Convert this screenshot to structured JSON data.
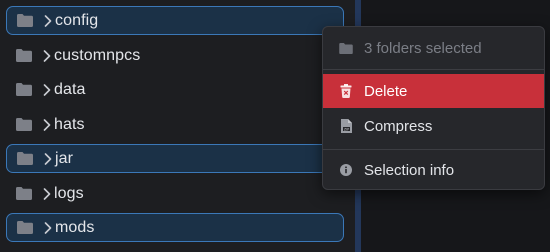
{
  "colors": {
    "background": "#1b1c1f",
    "selected_fill": "#1b3147",
    "selected_border": "#3b78b8",
    "danger": "#c8303a",
    "menu_bg": "#26272b"
  },
  "files": [
    {
      "name": "config",
      "selected": true,
      "icon": "folder-icon"
    },
    {
      "name": "customnpcs",
      "selected": false,
      "icon": "folder-icon"
    },
    {
      "name": "data",
      "selected": false,
      "icon": "folder-icon"
    },
    {
      "name": "hats",
      "selected": false,
      "icon": "folder-icon"
    },
    {
      "name": "jar",
      "selected": true,
      "icon": "folder-icon"
    },
    {
      "name": "logs",
      "selected": false,
      "icon": "folder-icon"
    },
    {
      "name": "mods",
      "selected": true,
      "icon": "folder-icon"
    }
  ],
  "context_menu": {
    "header": "3 folders selected",
    "items": [
      {
        "label": "Delete",
        "icon": "trash-icon",
        "variant": "danger"
      },
      {
        "label": "Compress",
        "icon": "zip-file-icon",
        "variant": "normal"
      },
      {
        "label": "Selection info",
        "icon": "info-icon",
        "variant": "normal"
      }
    ]
  }
}
